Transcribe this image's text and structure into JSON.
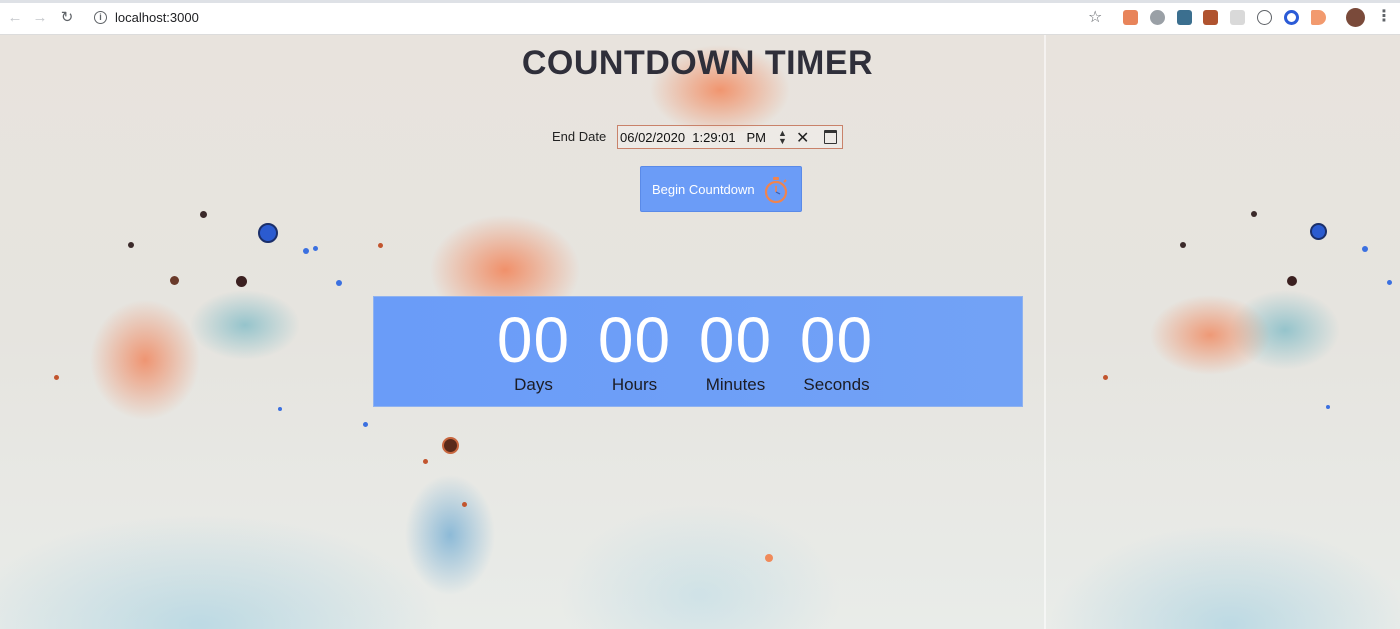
{
  "browser": {
    "url": "localhost:3000",
    "icons": [
      "back-icon",
      "forward-icon",
      "reload-icon",
      "info-icon",
      "star-icon",
      "menu-icon"
    ]
  },
  "page": {
    "title": "COUNTDOWN TIMER",
    "end_date": {
      "label": "End Date",
      "value": "06/02/2020  1:29:01   PM"
    },
    "begin_button": {
      "label": "Begin Countdown",
      "icon": "stopwatch-icon"
    },
    "timer": {
      "units": [
        {
          "value": "00",
          "label": "Days"
        },
        {
          "value": "00",
          "label": "Hours"
        },
        {
          "value": "00",
          "label": "Minutes"
        },
        {
          "value": "00",
          "label": "Seconds"
        }
      ],
      "background_color": "#6b9cf7"
    }
  },
  "colors": {
    "accent": "#6b9cf7",
    "title": "#2f2f3a"
  }
}
